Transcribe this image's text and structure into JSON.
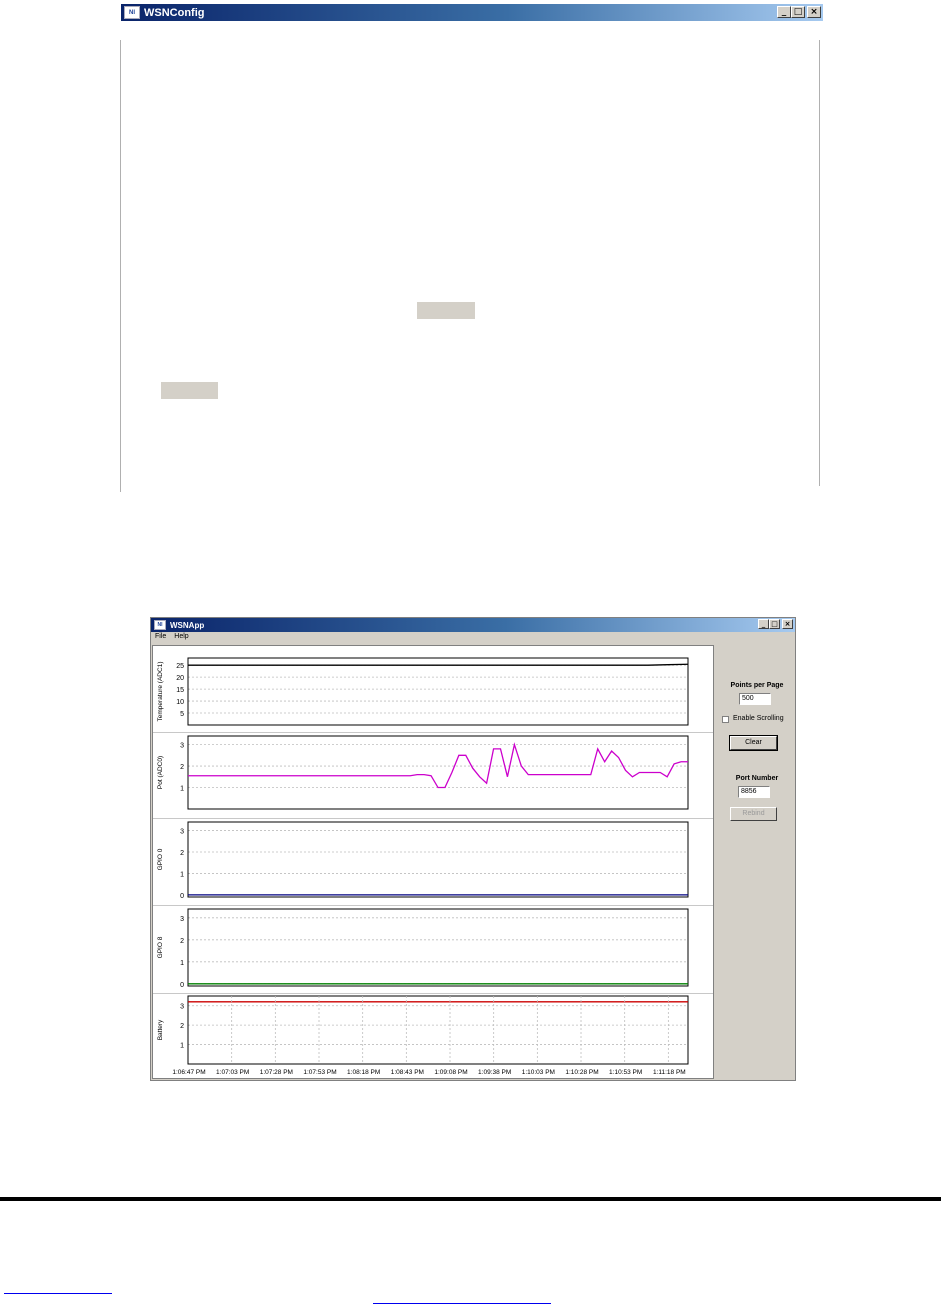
{
  "config_window": {
    "title": "WSNConfig",
    "icon": "ni-logo-icon",
    "title_buttons": [
      "_",
      "□",
      "×"
    ]
  },
  "app_window": {
    "title": "WSNApp",
    "icon": "ni-logo-icon",
    "title_buttons": [
      "_",
      "□",
      "×"
    ],
    "menu": [
      "File",
      "Help"
    ],
    "sidebar": {
      "points_label": "Points per Page",
      "points_value": "500",
      "scroll_label": "Enable Scrolling",
      "scroll_checked": false,
      "clear_label": "Clear",
      "port_label": "Port Number",
      "port_value": "8856",
      "rebind_label": "Rebind"
    },
    "time_ticks": [
      "1:06:47 PM",
      "1:07:03 PM",
      "1:07:28 PM",
      "1:07:53 PM",
      "1:08:18 PM",
      "1:08:43 PM",
      "1:09:08 PM",
      "1:09:38 PM",
      "1:10:03 PM",
      "1:10:28 PM",
      "1:10:53 PM",
      "1:11:18 PM"
    ]
  },
  "chart_data": [
    {
      "type": "line",
      "ylabel": "Temperature (ADC1)",
      "yticks": [
        5,
        10,
        15,
        20,
        25
      ],
      "ylim": [
        0,
        28
      ],
      "grid": true,
      "series": [
        {
          "color": "#000000",
          "y": [
            25,
            25,
            25,
            25,
            25,
            25,
            25,
            25,
            25,
            25,
            25,
            25,
            25,
            25,
            25,
            25,
            25,
            25,
            25,
            25,
            25,
            25,
            25,
            25,
            25.2,
            25.4
          ]
        }
      ]
    },
    {
      "type": "line",
      "ylabel": "Pot (ADC0)",
      "yticks": [
        1,
        2,
        3
      ],
      "ylim": [
        0,
        3.4
      ],
      "grid": true,
      "series": [
        {
          "color": "#cc00cc",
          "y": [
            1.55,
            1.55,
            1.55,
            1.55,
            1.55,
            1.55,
            1.55,
            1.55,
            1.55,
            1.55,
            1.55,
            1.55,
            1.55,
            1.55,
            1.55,
            1.55,
            1.55,
            1.55,
            1.55,
            1.55,
            1.55,
            1.55,
            1.55,
            1.55,
            1.55,
            1.55,
            1.55,
            1.55,
            1.55,
            1.55,
            1.55,
            1.55,
            1.55,
            1.6,
            1.6,
            1.55,
            1.0,
            1.0,
            1.7,
            2.5,
            2.5,
            1.9,
            1.5,
            1.2,
            2.8,
            2.8,
            1.5,
            3.0,
            2.0,
            1.6,
            1.6,
            1.6,
            1.6,
            1.6,
            1.6,
            1.6,
            1.6,
            1.6,
            1.6,
            2.8,
            2.2,
            2.7,
            2.4,
            1.8,
            1.5,
            1.7,
            1.7,
            1.7,
            1.7,
            1.5,
            2.1,
            2.2,
            2.2
          ]
        }
      ]
    },
    {
      "type": "line",
      "ylabel": "GPIO 0",
      "yticks": [
        0,
        1,
        2,
        3
      ],
      "ylim": [
        -0.1,
        3.4
      ],
      "grid": true,
      "series": [
        {
          "color": "#000080",
          "y": [
            0,
            0
          ]
        }
      ]
    },
    {
      "type": "line",
      "ylabel": "GPIO 8",
      "yticks": [
        0,
        1,
        2,
        3
      ],
      "ylim": [
        -0.1,
        3.4
      ],
      "grid": true,
      "series": [
        {
          "color": "#008000",
          "y": [
            0,
            0
          ]
        }
      ]
    },
    {
      "type": "line",
      "ylabel": "Battery",
      "yticks": [
        1,
        2,
        3
      ],
      "ylim": [
        0,
        3.5
      ],
      "grid": true,
      "series": [
        {
          "color": "#cc0000",
          "y": [
            3.2,
            3.2
          ]
        }
      ]
    }
  ]
}
